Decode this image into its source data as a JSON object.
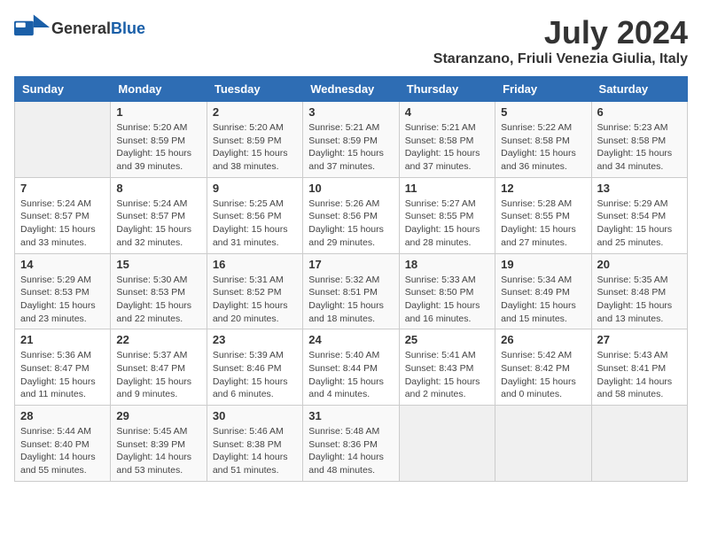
{
  "logo": {
    "general_text": "General",
    "blue_text": "Blue"
  },
  "title": {
    "month_year": "July 2024",
    "location": "Staranzano, Friuli Venezia Giulia, Italy"
  },
  "days_of_week": [
    "Sunday",
    "Monday",
    "Tuesday",
    "Wednesday",
    "Thursday",
    "Friday",
    "Saturday"
  ],
  "weeks": [
    [
      {
        "day": "",
        "details": ""
      },
      {
        "day": "1",
        "details": "Sunrise: 5:20 AM\nSunset: 8:59 PM\nDaylight: 15 hours\nand 39 minutes."
      },
      {
        "day": "2",
        "details": "Sunrise: 5:20 AM\nSunset: 8:59 PM\nDaylight: 15 hours\nand 38 minutes."
      },
      {
        "day": "3",
        "details": "Sunrise: 5:21 AM\nSunset: 8:59 PM\nDaylight: 15 hours\nand 37 minutes."
      },
      {
        "day": "4",
        "details": "Sunrise: 5:21 AM\nSunset: 8:58 PM\nDaylight: 15 hours\nand 37 minutes."
      },
      {
        "day": "5",
        "details": "Sunrise: 5:22 AM\nSunset: 8:58 PM\nDaylight: 15 hours\nand 36 minutes."
      },
      {
        "day": "6",
        "details": "Sunrise: 5:23 AM\nSunset: 8:58 PM\nDaylight: 15 hours\nand 34 minutes."
      }
    ],
    [
      {
        "day": "7",
        "details": "Sunrise: 5:24 AM\nSunset: 8:57 PM\nDaylight: 15 hours\nand 33 minutes."
      },
      {
        "day": "8",
        "details": "Sunrise: 5:24 AM\nSunset: 8:57 PM\nDaylight: 15 hours\nand 32 minutes."
      },
      {
        "day": "9",
        "details": "Sunrise: 5:25 AM\nSunset: 8:56 PM\nDaylight: 15 hours\nand 31 minutes."
      },
      {
        "day": "10",
        "details": "Sunrise: 5:26 AM\nSunset: 8:56 PM\nDaylight: 15 hours\nand 29 minutes."
      },
      {
        "day": "11",
        "details": "Sunrise: 5:27 AM\nSunset: 8:55 PM\nDaylight: 15 hours\nand 28 minutes."
      },
      {
        "day": "12",
        "details": "Sunrise: 5:28 AM\nSunset: 8:55 PM\nDaylight: 15 hours\nand 27 minutes."
      },
      {
        "day": "13",
        "details": "Sunrise: 5:29 AM\nSunset: 8:54 PM\nDaylight: 15 hours\nand 25 minutes."
      }
    ],
    [
      {
        "day": "14",
        "details": "Sunrise: 5:29 AM\nSunset: 8:53 PM\nDaylight: 15 hours\nand 23 minutes."
      },
      {
        "day": "15",
        "details": "Sunrise: 5:30 AM\nSunset: 8:53 PM\nDaylight: 15 hours\nand 22 minutes."
      },
      {
        "day": "16",
        "details": "Sunrise: 5:31 AM\nSunset: 8:52 PM\nDaylight: 15 hours\nand 20 minutes."
      },
      {
        "day": "17",
        "details": "Sunrise: 5:32 AM\nSunset: 8:51 PM\nDaylight: 15 hours\nand 18 minutes."
      },
      {
        "day": "18",
        "details": "Sunrise: 5:33 AM\nSunset: 8:50 PM\nDaylight: 15 hours\nand 16 minutes."
      },
      {
        "day": "19",
        "details": "Sunrise: 5:34 AM\nSunset: 8:49 PM\nDaylight: 15 hours\nand 15 minutes."
      },
      {
        "day": "20",
        "details": "Sunrise: 5:35 AM\nSunset: 8:48 PM\nDaylight: 15 hours\nand 13 minutes."
      }
    ],
    [
      {
        "day": "21",
        "details": "Sunrise: 5:36 AM\nSunset: 8:47 PM\nDaylight: 15 hours\nand 11 minutes."
      },
      {
        "day": "22",
        "details": "Sunrise: 5:37 AM\nSunset: 8:47 PM\nDaylight: 15 hours\nand 9 minutes."
      },
      {
        "day": "23",
        "details": "Sunrise: 5:39 AM\nSunset: 8:46 PM\nDaylight: 15 hours\nand 6 minutes."
      },
      {
        "day": "24",
        "details": "Sunrise: 5:40 AM\nSunset: 8:44 PM\nDaylight: 15 hours\nand 4 minutes."
      },
      {
        "day": "25",
        "details": "Sunrise: 5:41 AM\nSunset: 8:43 PM\nDaylight: 15 hours\nand 2 minutes."
      },
      {
        "day": "26",
        "details": "Sunrise: 5:42 AM\nSunset: 8:42 PM\nDaylight: 15 hours\nand 0 minutes."
      },
      {
        "day": "27",
        "details": "Sunrise: 5:43 AM\nSunset: 8:41 PM\nDaylight: 14 hours\nand 58 minutes."
      }
    ],
    [
      {
        "day": "28",
        "details": "Sunrise: 5:44 AM\nSunset: 8:40 PM\nDaylight: 14 hours\nand 55 minutes."
      },
      {
        "day": "29",
        "details": "Sunrise: 5:45 AM\nSunset: 8:39 PM\nDaylight: 14 hours\nand 53 minutes."
      },
      {
        "day": "30",
        "details": "Sunrise: 5:46 AM\nSunset: 8:38 PM\nDaylight: 14 hours\nand 51 minutes."
      },
      {
        "day": "31",
        "details": "Sunrise: 5:48 AM\nSunset: 8:36 PM\nDaylight: 14 hours\nand 48 minutes."
      },
      {
        "day": "",
        "details": ""
      },
      {
        "day": "",
        "details": ""
      },
      {
        "day": "",
        "details": ""
      }
    ]
  ]
}
